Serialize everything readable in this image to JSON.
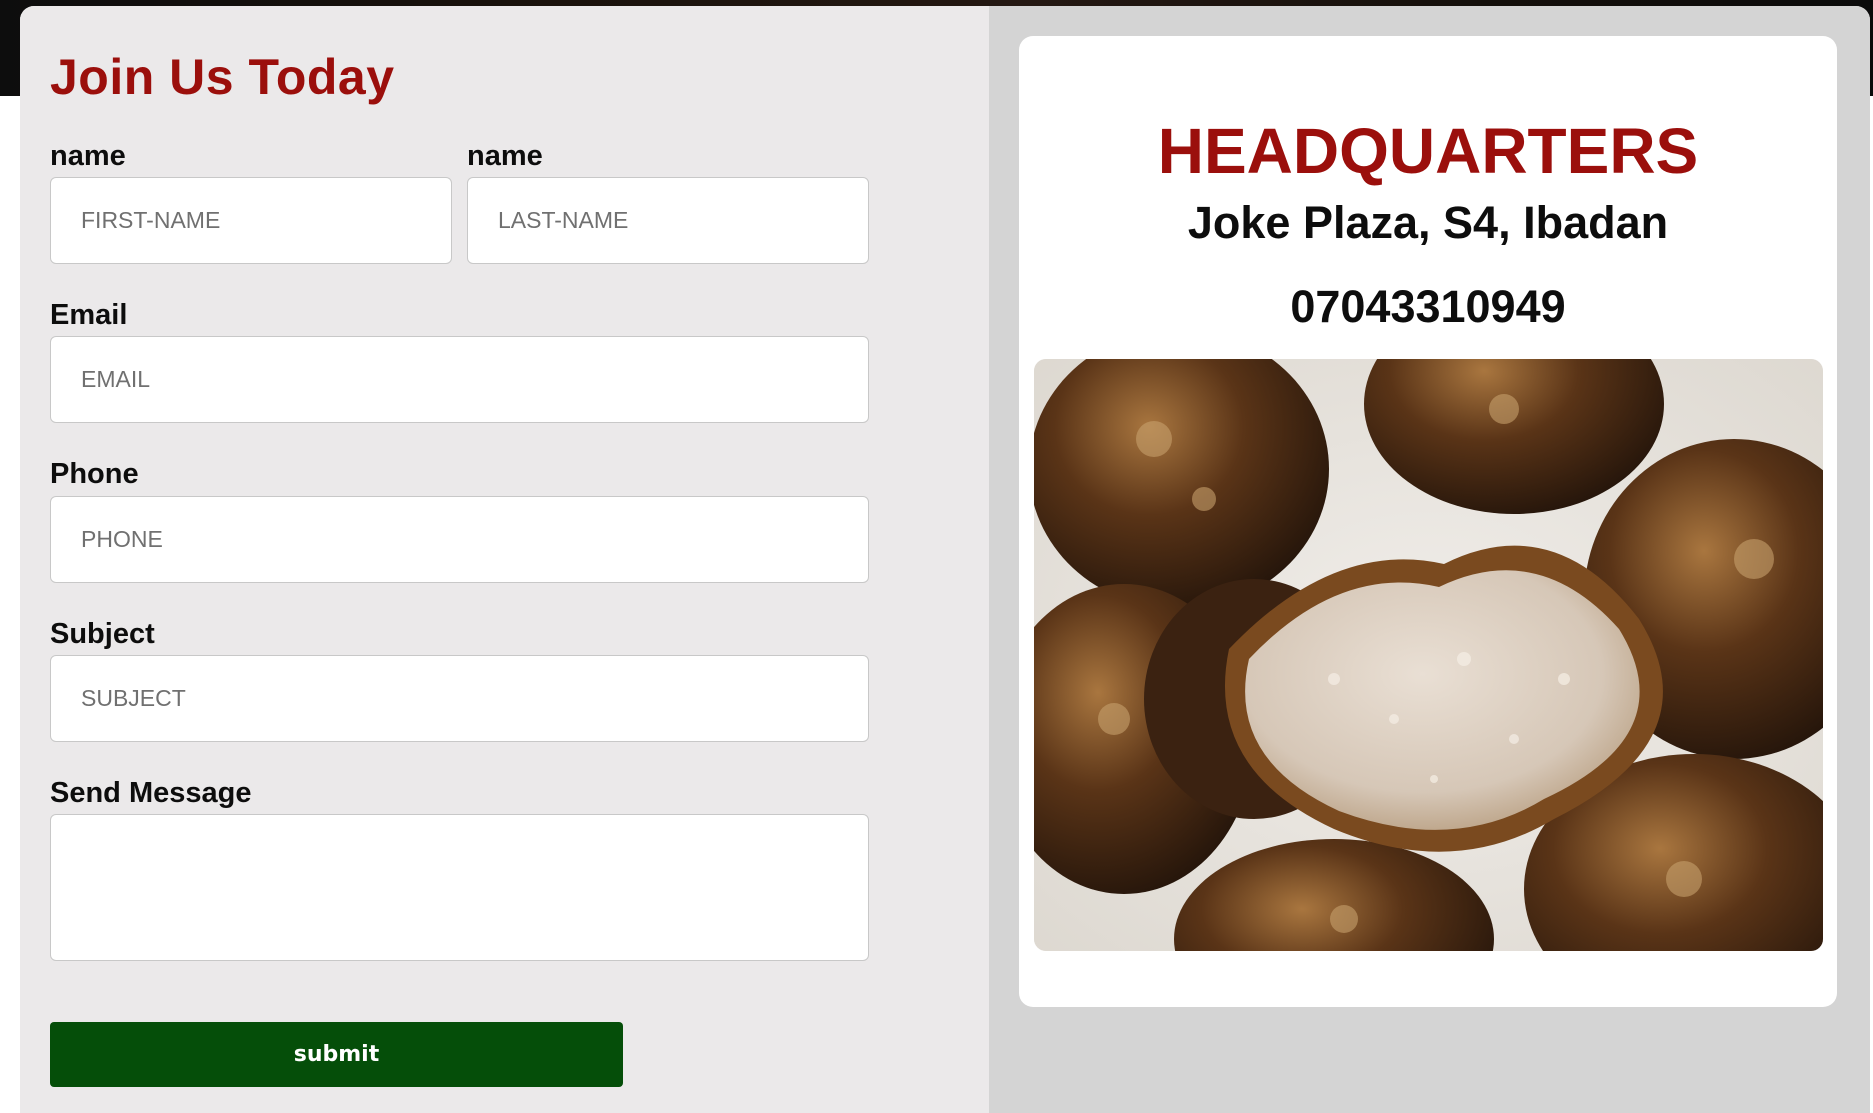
{
  "form": {
    "title": "Join Us Today",
    "first_name": {
      "label": "name",
      "placeholder": "FIRST-NAME"
    },
    "last_name": {
      "label": "name",
      "placeholder": "LAST-NAME"
    },
    "email": {
      "label": "Email",
      "placeholder": "EMAIL"
    },
    "phone": {
      "label": "Phone",
      "placeholder": "PHONE"
    },
    "subject": {
      "label": "Subject",
      "placeholder": "SUBJECT"
    },
    "message": {
      "label": "Send Message"
    },
    "submit_label": "submit"
  },
  "headquarters": {
    "title": "HEADQUARTERS",
    "address": "Joke Plaza, S4, Ibadan",
    "phone": "07043310949"
  },
  "colors": {
    "accent_red": "#9b0f0c",
    "submit_green": "#054e09",
    "form_background": "#ebe9ea",
    "info_background": "#d4d4d4"
  }
}
